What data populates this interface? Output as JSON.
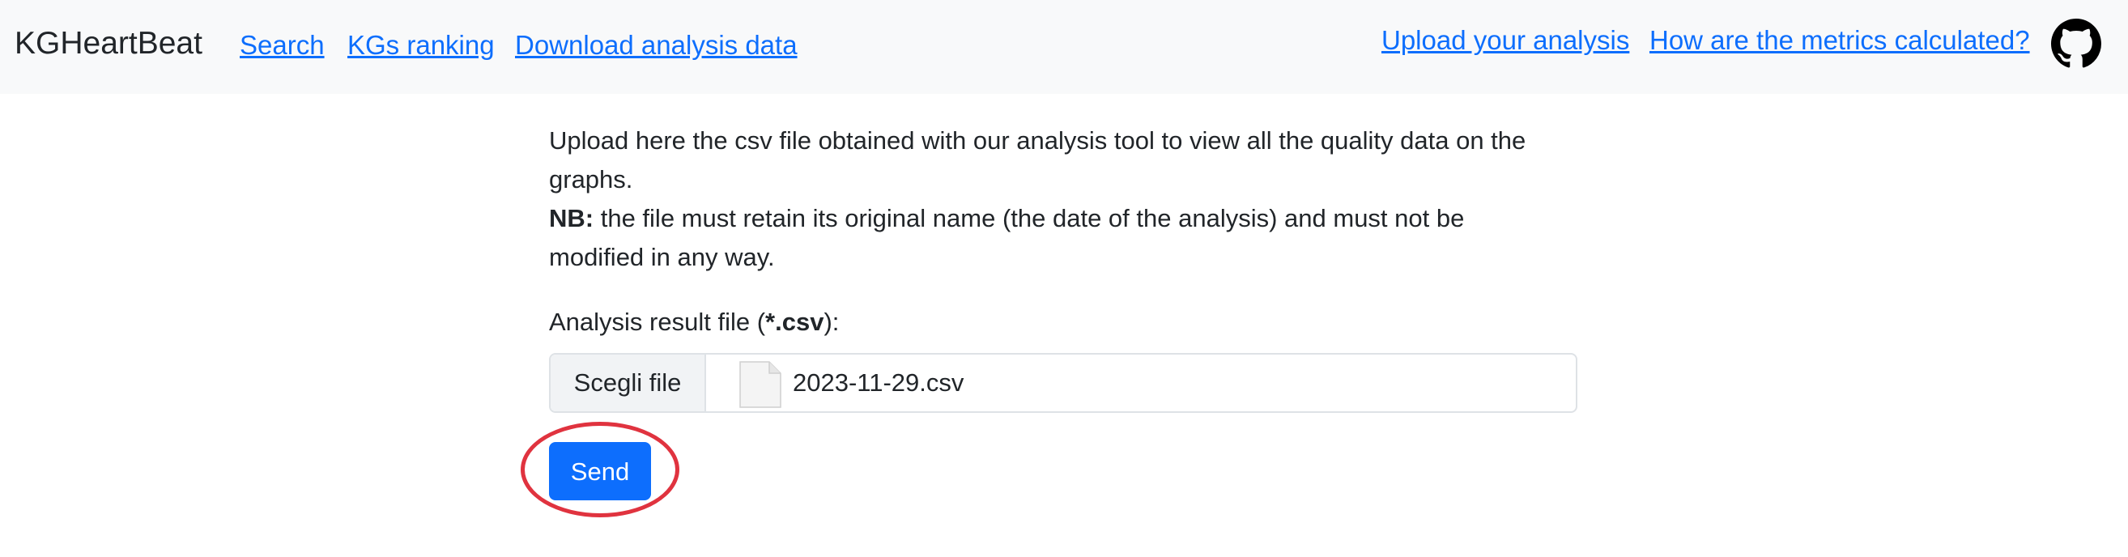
{
  "navbar": {
    "brand": "KGHeartBeat",
    "links_left": [
      "Search",
      "KGs ranking",
      "Download analysis data"
    ],
    "links_right": [
      "Upload your analysis",
      "How are the metrics calculated?"
    ],
    "github_icon": "github-icon",
    "link_color": "#0d6efd"
  },
  "main": {
    "description_line1": "Upload here the csv file obtained with our analysis tool to view all the quality data on the graphs.",
    "nb_label": "NB:",
    "description_line2": " the file must retain its original name (the date of the analysis) and must not be modified in any way.",
    "file_label_prefix": "Analysis result file (",
    "file_label_ext": "*.csv",
    "file_label_suffix": "):",
    "file_button_label": "Scegli file",
    "file_icon": "file-icon",
    "selected_file": "2023-11-29.csv",
    "send_label": "Send",
    "send_color": "#0d6efd",
    "highlight_color": "#e0333f"
  }
}
